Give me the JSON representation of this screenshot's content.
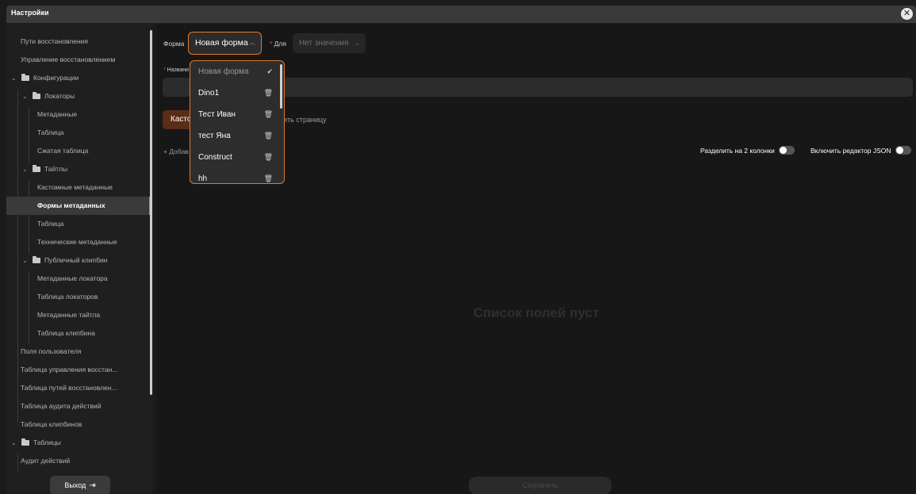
{
  "window": {
    "title": "Настройки",
    "close_icon": "close-icon"
  },
  "sidebar": {
    "items": [
      {
        "label": "Пути восстановления"
      },
      {
        "label": "Управление восстановлением"
      },
      {
        "label": "Конфигурации"
      },
      {
        "label": "Локаторы"
      },
      {
        "label": "Метаданные"
      },
      {
        "label": "Таблица"
      },
      {
        "label": "Сжатая таблица"
      },
      {
        "label": "Тайтлы"
      },
      {
        "label": "Кастомные метаданные"
      },
      {
        "label": "Формы метаданных"
      },
      {
        "label": "Таблица"
      },
      {
        "label": "Технические метаданные"
      },
      {
        "label": "Публичный клипбин"
      },
      {
        "label": "Метаданные локатора"
      },
      {
        "label": "Таблица локаторов"
      },
      {
        "label": "Метаданные тайтла"
      },
      {
        "label": "Таблица клипбина"
      },
      {
        "label": "Поля пользователя"
      },
      {
        "label": "Таблица управления восстан..."
      },
      {
        "label": "Таблица путей восстановлен..."
      },
      {
        "label": "Таблица аудита действий"
      },
      {
        "label": "Таблица клипбинов"
      },
      {
        "label": "Таблицы"
      },
      {
        "label": "Аудит действий"
      }
    ],
    "active_item": "Формы метаданных",
    "exit_label": "Выход"
  },
  "form": {
    "form_label": "Форма",
    "form_value": "Новая форма",
    "for_label": "Для",
    "for_value": "Нет значения",
    "name_label": "Названи",
    "custom_btn_label": "Кастомная",
    "seg_label": "ить страницу",
    "add_label": "+ Добав",
    "split_label": "Разделить на 2 колонки",
    "json_label": "Включить редактор JSON",
    "empty_label": "Список полей пуст",
    "save_label": "Сохранить"
  },
  "dropdown": {
    "options": [
      {
        "label": "Новая форма",
        "selected": true
      },
      {
        "label": "Dino1"
      },
      {
        "label": "Тест Иван"
      },
      {
        "label": "тест Яна"
      },
      {
        "label": "Construct"
      },
      {
        "label": "hh"
      }
    ]
  },
  "colors": {
    "accent": "#e07a2a",
    "required": "#e0533d",
    "background": "#171717",
    "sidebar": "#1f1f1f"
  }
}
